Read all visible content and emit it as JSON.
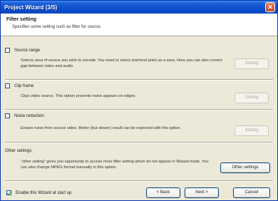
{
  "window": {
    "title": "Project Wizard (3/5)",
    "close_glyph": "✕"
  },
  "header": {
    "title": "Filter setting",
    "subtitle": "Specifies some setting such as filter for source."
  },
  "options": [
    {
      "label": "Source range",
      "checked": false,
      "description": "Selects area of source you wish to encode. You need to select start/end point as a area. Here you can also correct gap between video and audio.",
      "button": "Setting"
    },
    {
      "label": "Clip frame",
      "checked": false,
      "description": "Clips video source. This option prevents noise appears on edges.",
      "button": "Setting"
    },
    {
      "label": "Noise reduction",
      "checked": false,
      "description": "Erases noise from source video. Better (but slower) result can be expected with this option.",
      "button": "Setting"
    }
  ],
  "other": {
    "label": "Other settings",
    "description": "\"other setting\" gives you opportunity to access more filter setting which do not appear in Wizard mode. You can also change MPEG format manually in this option.",
    "button": "Other settings"
  },
  "footer": {
    "startup_label": "Enable this Wizard at start up",
    "startup_checked": true,
    "back": "< Back",
    "next": "Next >",
    "cancel": "Cancel"
  }
}
